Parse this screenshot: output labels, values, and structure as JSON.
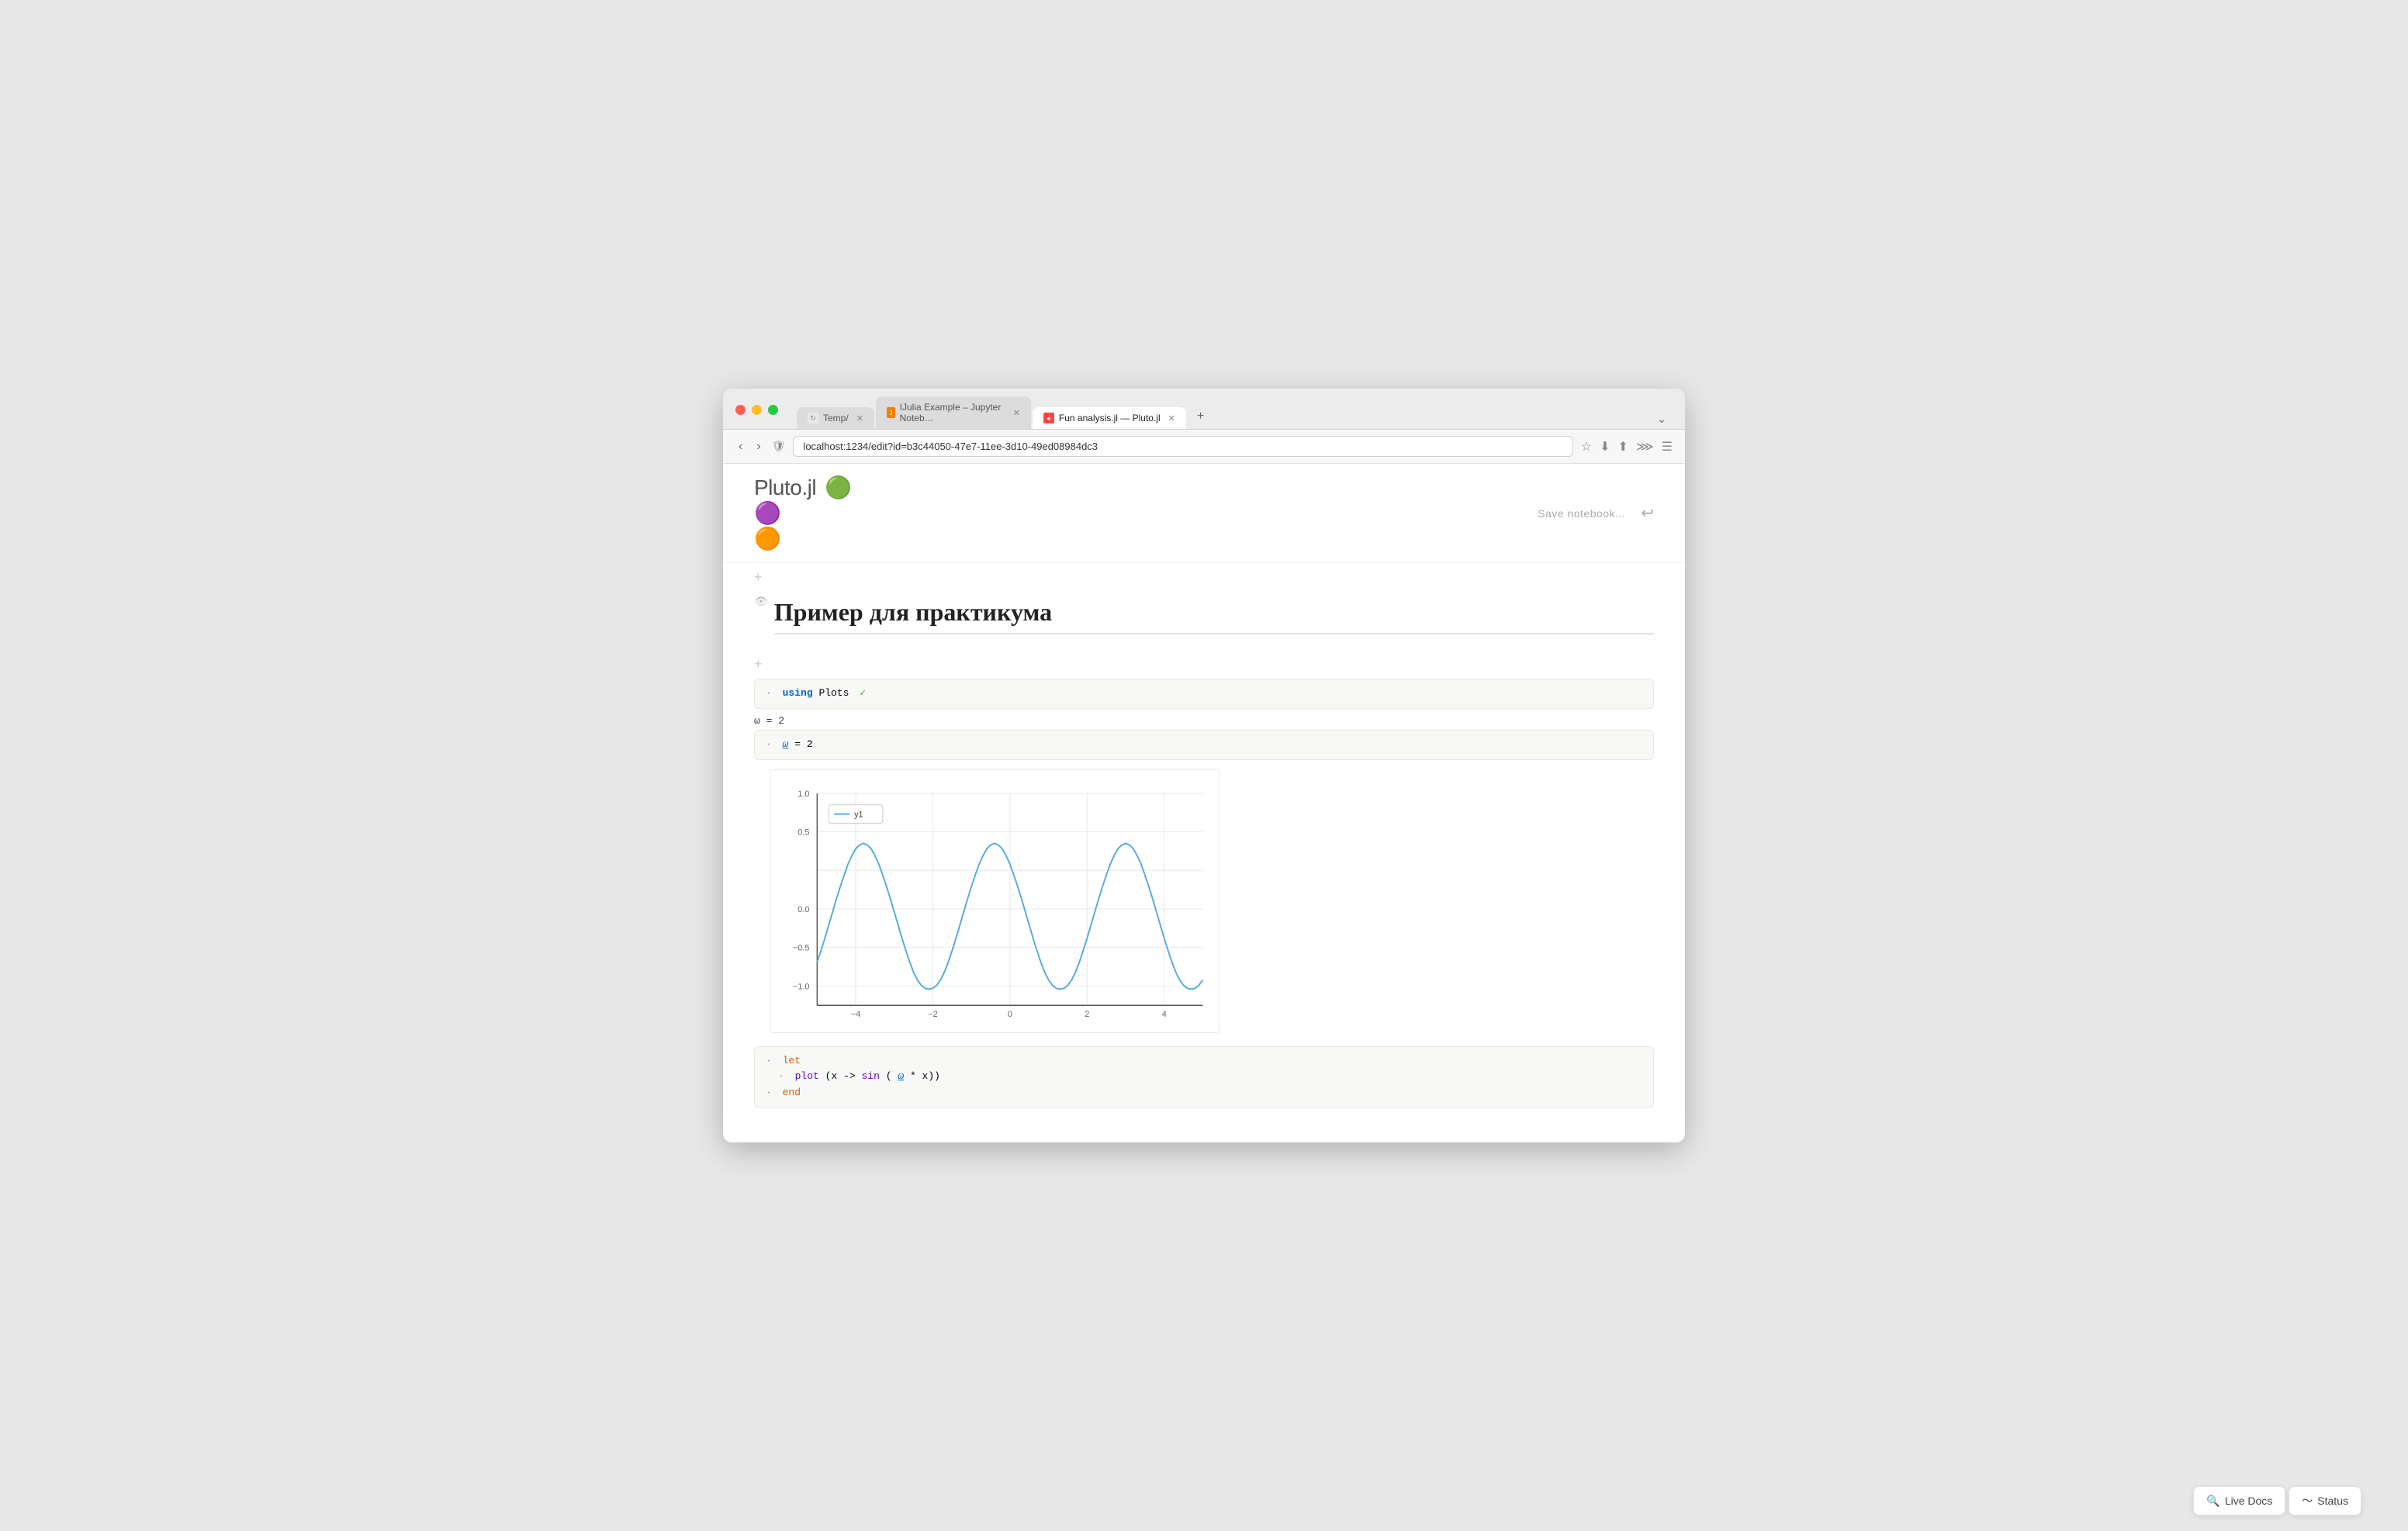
{
  "browser": {
    "tabs": [
      {
        "id": "temp",
        "label": "Temp/",
        "icon": "🔄",
        "active": false,
        "closeable": true
      },
      {
        "id": "jupyter",
        "label": "IJulia Example – Jupyter Noteb…",
        "icon": "📓",
        "active": false,
        "closeable": true
      },
      {
        "id": "pluto",
        "label": "Fun analysis.jl — Pluto.jl",
        "icon": "🔴",
        "active": true,
        "closeable": true
      }
    ],
    "url": "localhost:1234/edit?id=b3c44050-47e7-11ee-3d10-49ed08984dc3",
    "tab_list_icon": "⌄"
  },
  "pluto": {
    "logo_text": "Pluto",
    "logo_suffix": ".jl",
    "logo_emoji": "🟢🟣🟠",
    "save_label": "Save notebook...",
    "undo_symbol": "↩"
  },
  "notebook": {
    "title": "Пример для практикума",
    "cells": [
      {
        "id": "cell-using",
        "code_lines": [
          "using Plots ✓"
        ],
        "has_bullet": true
      },
      {
        "id": "cell-omega",
        "omega_display": "ω = 2",
        "code_lines": [
          "ω = 2"
        ]
      },
      {
        "id": "cell-let",
        "code_lines": [
          "let",
          "    plot(x -> sin(ω * x))",
          "end"
        ]
      }
    ],
    "plot": {
      "legend": "y1",
      "x_axis_labels": [
        "-4",
        "-2",
        "0",
        "2",
        "4"
      ],
      "y_axis_labels": [
        "-1.0",
        "-0.5",
        "0.0",
        "0.5",
        "1.0"
      ],
      "color": "#5aacdd"
    }
  },
  "bottom_bar": {
    "live_docs_label": "Live Docs",
    "status_label": "Status",
    "live_docs_icon": "🔍",
    "status_icon": "〜"
  }
}
